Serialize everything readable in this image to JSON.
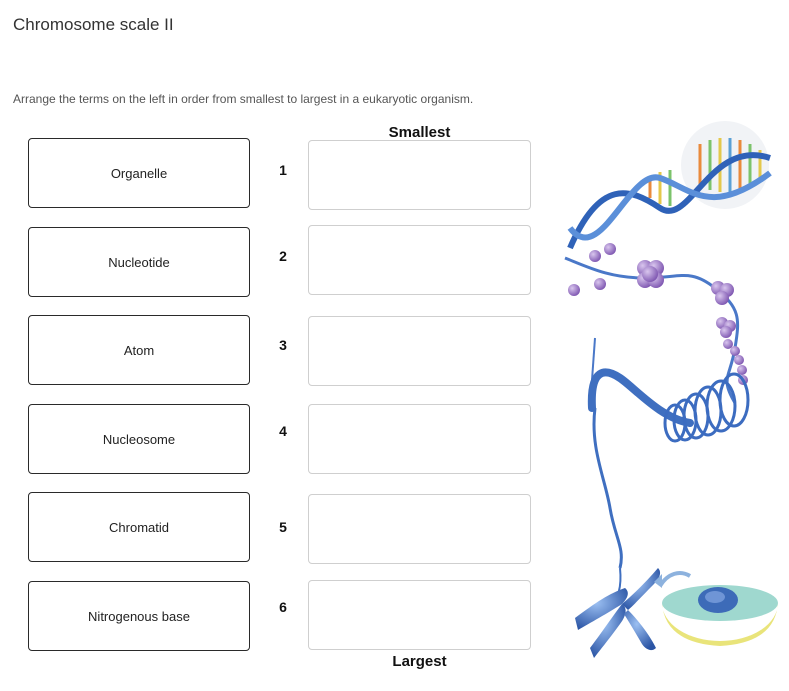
{
  "title": "Chromosome scale II",
  "instructions": "Arrange the terms on the left in order from smallest to largest in a eukaryotic organism.",
  "order_labels": {
    "top": "Smallest",
    "bottom": "Largest"
  },
  "terms": [
    "Organelle",
    "Nucleotide",
    "Atom",
    "Nucleosome",
    "Chromatid",
    "Nitrogenous base"
  ],
  "slot_numbers": [
    "1",
    "2",
    "3",
    "4",
    "5",
    "6"
  ],
  "colors": {
    "dna_blue": "#3a6fc4",
    "histone_purple": "#9a72c4",
    "nucleus_yellow": "#e9e47a",
    "cell_teal": "#9fd8cf"
  }
}
